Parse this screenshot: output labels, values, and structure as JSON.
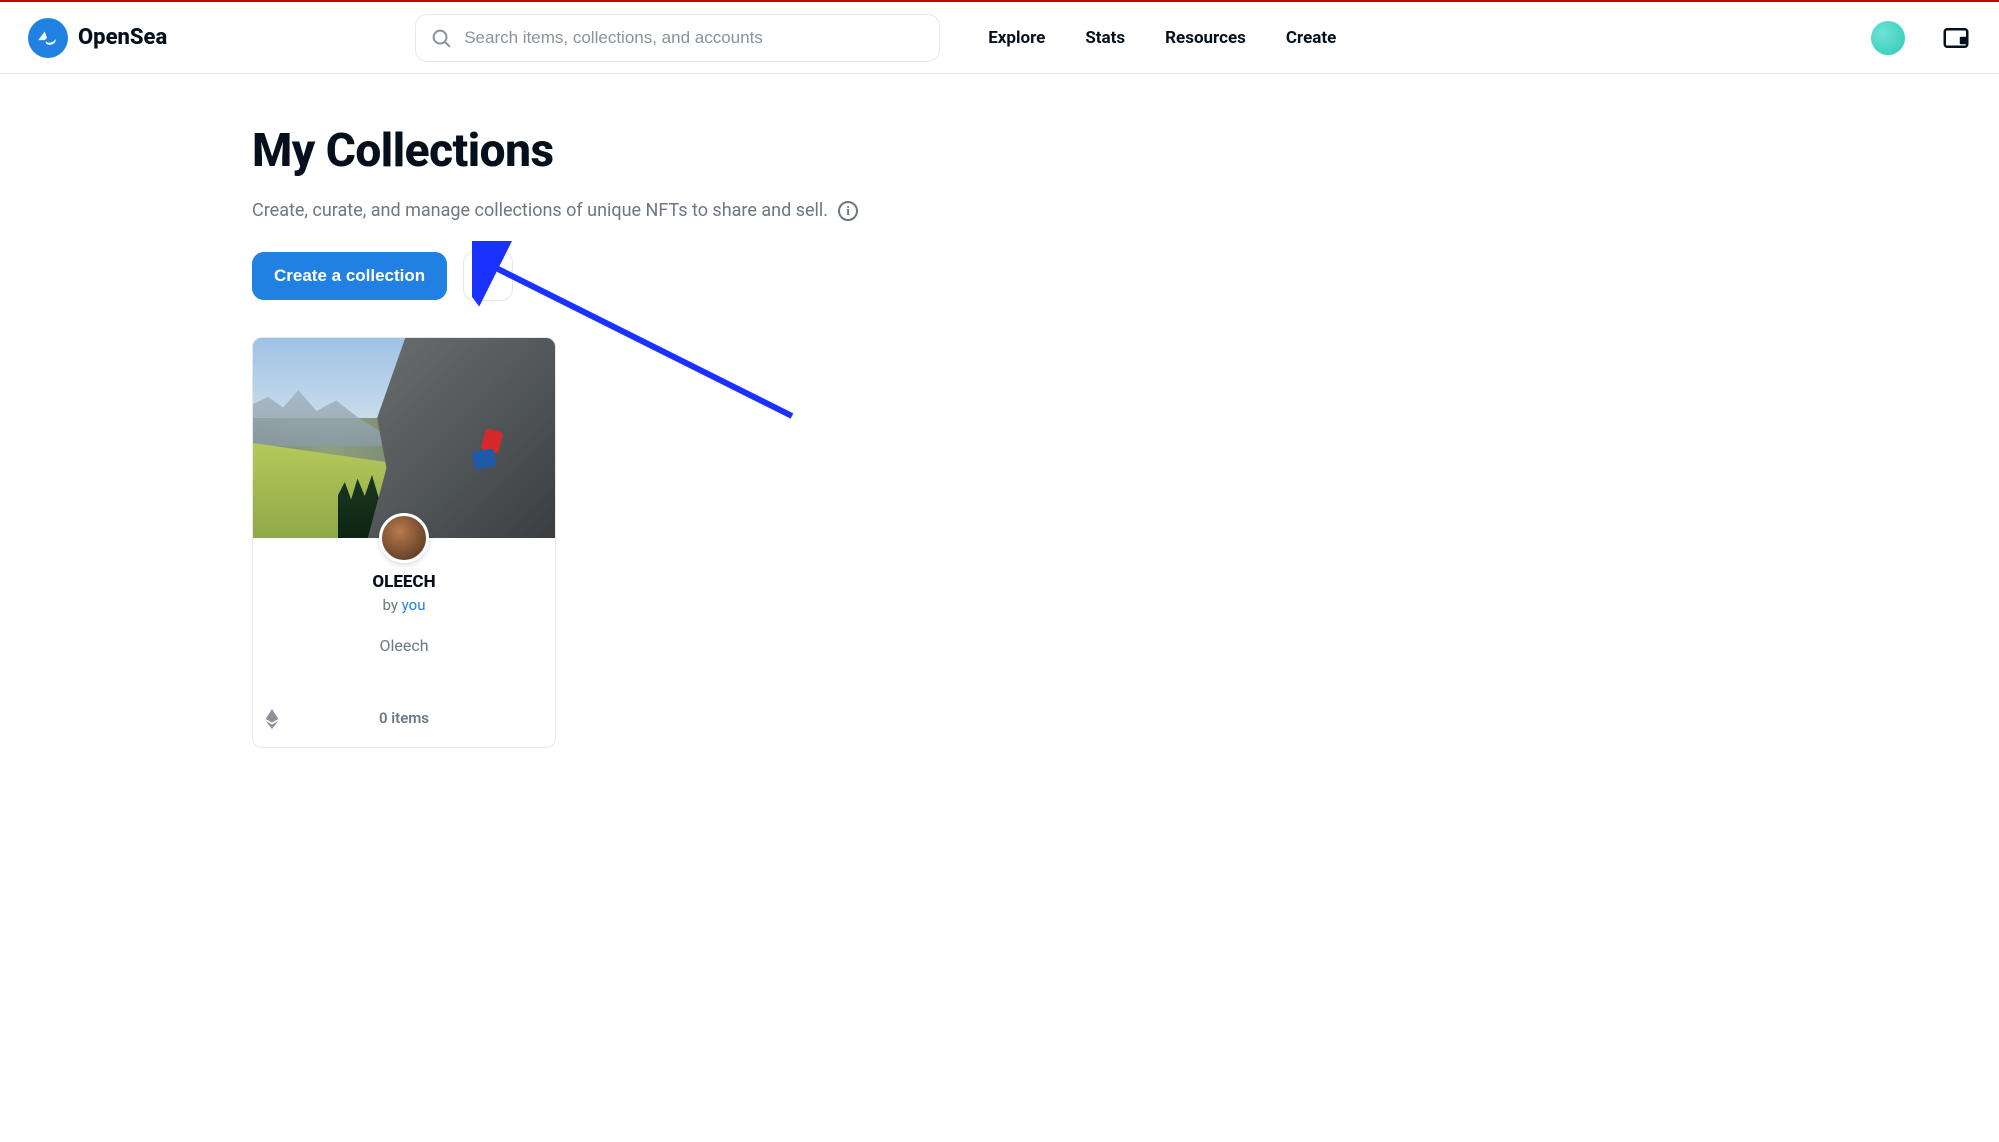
{
  "brand": {
    "name": "OpenSea"
  },
  "search": {
    "placeholder": "Search items, collections, and accounts"
  },
  "nav": {
    "explore": "Explore",
    "stats": "Stats",
    "resources": "Resources",
    "create": "Create"
  },
  "page": {
    "title": "My Collections",
    "subtitle": "Create, curate, and manage collections of unique NFTs to share and sell.",
    "create_button": "Create a collection"
  },
  "collection_card": {
    "name": "OLEECH",
    "by_prefix": "by ",
    "by_link": "you",
    "description": "Oleech",
    "items_count": "0 items"
  }
}
